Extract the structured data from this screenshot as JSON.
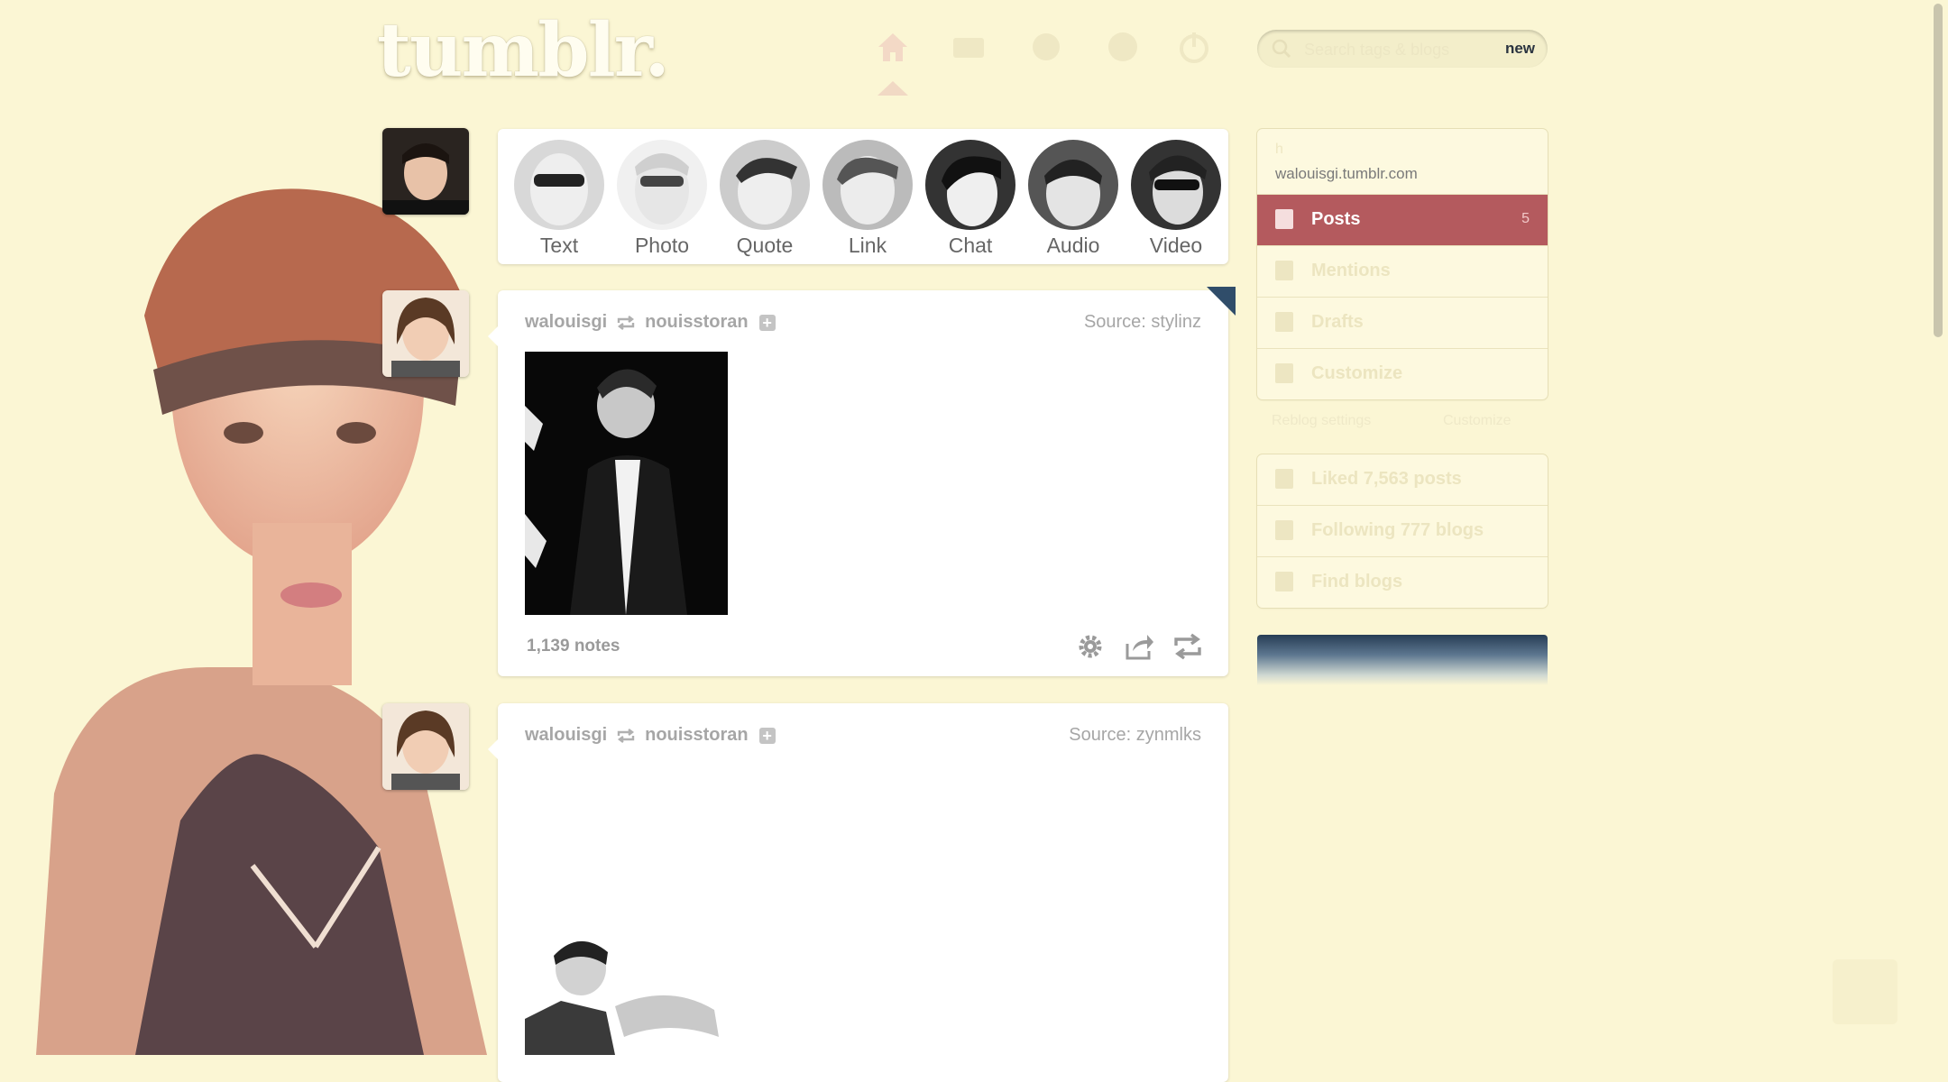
{
  "header": {
    "logo": "tumblr.",
    "search_placeholder": "Search tags & blogs",
    "search_badge": "new",
    "nav": [
      "home-icon",
      "inbox-icon",
      "settings-icon",
      "help-icon",
      "logout-icon"
    ]
  },
  "post_types": [
    {
      "label": "Text"
    },
    {
      "label": "Photo"
    },
    {
      "label": "Quote"
    },
    {
      "label": "Link"
    },
    {
      "label": "Chat"
    },
    {
      "label": "Audio"
    },
    {
      "label": "Video"
    }
  ],
  "posts": [
    {
      "author": "walouisgi",
      "reblogged_from": "nouisstoran",
      "source": "Source: stylinz",
      "notes": "1,139 notes"
    },
    {
      "author": "walouisgi",
      "reblogged_from": "nouisstoran",
      "source": "Source: zynmlks"
    }
  ],
  "sidebar": {
    "blog_name": "h",
    "blog_url": "walouisgi.tumblr.com",
    "menu": [
      {
        "label": "Posts",
        "count": "5",
        "icon": "posts-icon",
        "active": true
      },
      {
        "label": "Mentions",
        "count": "",
        "icon": "mentions-icon"
      },
      {
        "label": "Drafts",
        "count": "",
        "icon": "drafts-icon"
      },
      {
        "label": "Customize",
        "count": "",
        "icon": "customize-icon"
      }
    ],
    "faint_left": "Reblog settings",
    "faint_right": "Customize",
    "activity": [
      {
        "label": "Liked 7,563 posts",
        "icon": "heart-icon"
      },
      {
        "label": "Following 777 blogs",
        "icon": "following-icon"
      },
      {
        "label": "Find blogs",
        "icon": "find-icon"
      }
    ]
  },
  "colors": {
    "background": "#fbf6d4",
    "accent": "#b45a5e",
    "radar": "#273d55"
  }
}
